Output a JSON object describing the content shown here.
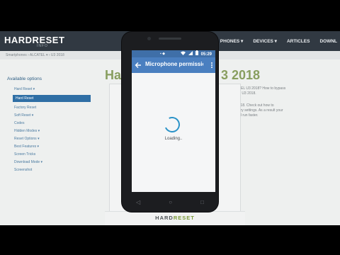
{
  "site": {
    "logo": "HARDRESET",
    "logo_sub": "INFO",
    "nav": [
      "PHONES ▾",
      "DEVICES ▾",
      "ARTICLES",
      "DOWNL"
    ],
    "breadcrumb": "Smartphones › ALCATEL ▾ › U3 2018",
    "sidebar": {
      "title": "Available options",
      "items": [
        {
          "label": "Hard Reset ▾",
          "active": false
        },
        {
          "label": "Hard Reset",
          "active": true
        },
        {
          "label": "Factory Reset",
          "active": false
        },
        {
          "label": "Soft Reset ▾",
          "active": false
        },
        {
          "label": "Codes",
          "active": false
        },
        {
          "label": "Hidden Modes ▾",
          "active": false
        },
        {
          "label": "Reset Options ▾",
          "active": false
        },
        {
          "label": "Best Features ▾",
          "active": false
        },
        {
          "label": "Screen Tricks",
          "active": false
        },
        {
          "label": "Download Mode ▾",
          "active": false
        },
        {
          "label": "Screenshot",
          "active": false
        }
      ]
    },
    "heading_left": "Ha",
    "heading_right": "3 2018",
    "paragraphs": [
      "ATEL U3 2018? How to bypass",
      "EL U3 2018.",
      "2018. Check out how to",
      "ttery settings. As a result your",
      "will run faster."
    ]
  },
  "phone": {
    "status_bar": {
      "time": "05:29",
      "icons": [
        "wifi-icon",
        "signal-icon",
        "battery-icon"
      ],
      "left_icons": [
        "notification-icon",
        "app-icon"
      ]
    },
    "app_bar": {
      "back_icon": "arrow-back-icon",
      "title": "Microphone permissio...",
      "menu_icon": "more-vert-icon"
    },
    "loading_text": "Loading..",
    "nav_buttons": [
      "back-nav-icon",
      "home-nav-icon",
      "recents-nav-icon"
    ]
  },
  "stand": {
    "brand_prefix": "HARD",
    "brand_suffix": "RESET"
  },
  "colors": {
    "status_bar": "#3f6fa8",
    "app_bar": "#4a7fc0",
    "spinner": "#2b93c8",
    "site_header": "#313942",
    "site_heading": "#6f8a3c"
  }
}
